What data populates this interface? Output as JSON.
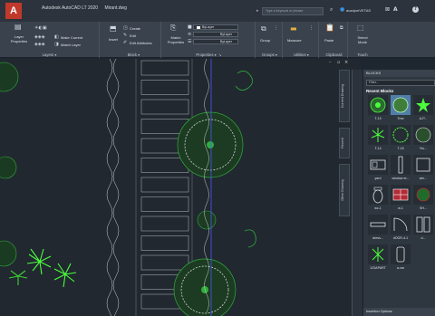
{
  "titlebar": {
    "app_name": "Autodesk AutoCAD LT 2020",
    "file_name": "Mirant.dwg",
    "search_placeholder": "Type a keyword or phrase",
    "user_name": "acadpmVETAS",
    "help_glyph": "?"
  },
  "ribbon": {
    "layers": {
      "label": "Layers",
      "layer_properties": "Layer Properties",
      "make_current": "Make Current",
      "match_layer": "Match Layer"
    },
    "block": {
      "label": "Block",
      "insert": "Insert",
      "create": "Create",
      "edit": "Edit",
      "edit_attributes": "Edit Attributes"
    },
    "properties": {
      "label": "Properties",
      "match_properties": "Match Properties",
      "by_layer_color": "ByLayer",
      "by_layer_linetype": "ByLayer",
      "by_layer_lineweight": "ByLayer"
    },
    "groups": {
      "label": "Groups",
      "group": "Group"
    },
    "utilities": {
      "label": "Utilities",
      "measure": "Measure"
    },
    "clipboard": {
      "label": "Clipboard",
      "paste": "Paste"
    },
    "touch": {
      "label": "Touch",
      "select_mode": "Select Mode"
    }
  },
  "palette": {
    "header": "BLOCKS",
    "filter_placeholder": "Filter...",
    "recent_title": "Recent Blocks",
    "side_tabs": [
      "Current Drawing",
      "Recent",
      "Other Drawing"
    ],
    "blocks": [
      {
        "label": "T-19"
      },
      {
        "label": "Tree"
      },
      {
        "label": "A-P..."
      },
      {
        "label": "T-14"
      },
      {
        "label": "T-15"
      },
      {
        "label": "*riu..."
      },
      {
        "label": "yard"
      },
      {
        "label": "window er..."
      },
      {
        "label": "win..."
      },
      {
        "label": "wc-1"
      },
      {
        "label": "w-1"
      },
      {
        "label": "SH..."
      },
      {
        "label": "dress..."
      },
      {
        "label": "dOOR-4-1"
      },
      {
        "label": "d..."
      },
      {
        "label": "123APART"
      },
      {
        "label": "a-car"
      }
    ],
    "insertion_options": "Insertion Options"
  },
  "colors": {
    "canvas_bg": "#212830",
    "tree_green": "#2fae3a",
    "bright_plant": "#4cff3c",
    "accent_blue": "#3d8ee0"
  }
}
